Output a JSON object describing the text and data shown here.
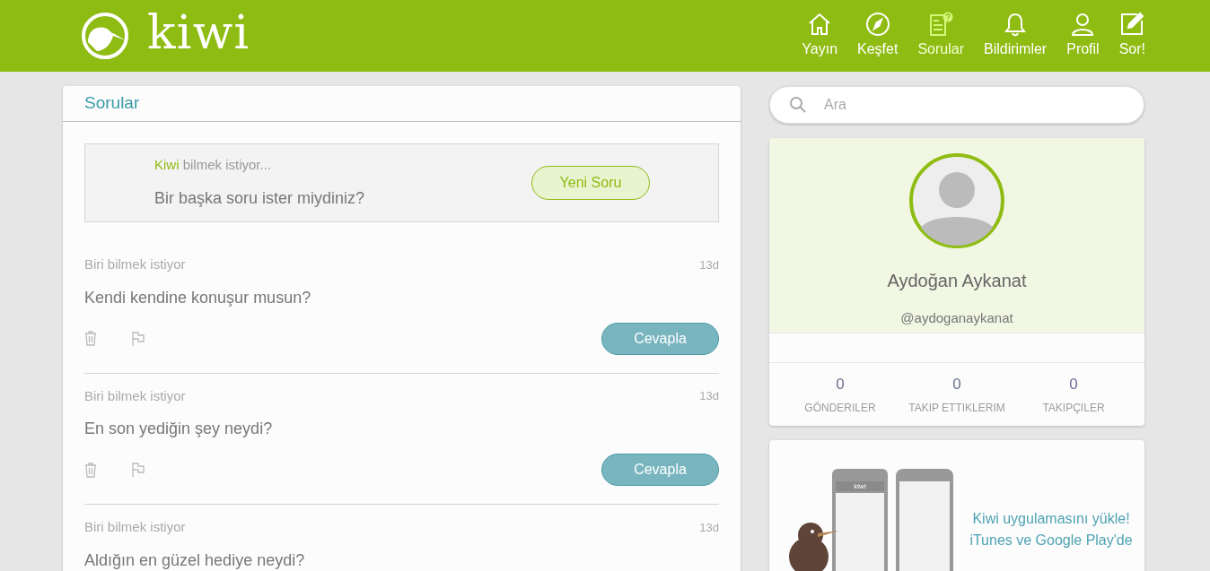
{
  "header": {
    "logo_text": "kiwi",
    "nav": [
      {
        "label": "Yayın",
        "kind": "home",
        "selected": false
      },
      {
        "label": "Keşfet",
        "kind": "compass",
        "selected": false
      },
      {
        "label": "Sorular",
        "kind": "questions",
        "selected": true
      },
      {
        "label": "Bildirimler",
        "kind": "bell",
        "selected": false
      },
      {
        "label": "Profil",
        "kind": "user",
        "selected": false
      },
      {
        "label": "Sor!",
        "kind": "edit",
        "selected": false
      }
    ]
  },
  "feed": {
    "title": "Sorular",
    "prompt": {
      "asker": "Kiwi",
      "asker_suffix": "bilmek istiyor...",
      "question": "Bir başka soru ister miydiniz?",
      "button": "Yeni Soru"
    },
    "questions": [
      {
        "asker": "Biri bilmek istiyor",
        "time": "13d",
        "text": "Kendi kendine konuşur musun?",
        "answer_label": "Cevapla"
      },
      {
        "asker": "Biri bilmek istiyor",
        "time": "13d",
        "text": "En son yediğin şey neydi?",
        "answer_label": "Cevapla"
      },
      {
        "asker": "Biri bilmek istiyor",
        "time": "13d",
        "text": "Aldığın en güzel hediye neydi?"
      }
    ]
  },
  "search": {
    "placeholder": "Ara"
  },
  "profile": {
    "name": "Aydoğan Aykanat",
    "handle": "@aydoganaykanat",
    "stats": [
      {
        "value": "0",
        "label": "GÖNDERILER"
      },
      {
        "value": "0",
        "label": "TAKIP ETTIKLERIM"
      },
      {
        "value": "0",
        "label": "TAKIPÇILER"
      }
    ]
  },
  "promo": {
    "phone_label": "kiwi",
    "lines": [
      "Kiwi uygulamasını yükle!",
      "iTunes ve Google Play'de"
    ]
  }
}
